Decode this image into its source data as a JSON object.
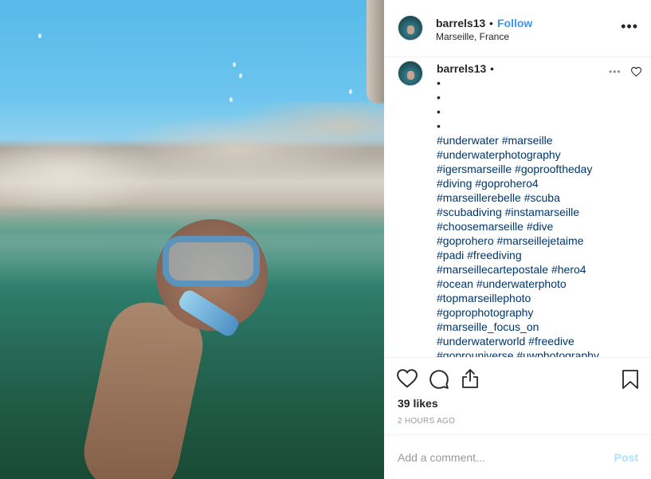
{
  "post": {
    "username": "barrels13",
    "separator": "•",
    "follow_label": "Follow",
    "location": "Marseille, France",
    "more_icon": "more-horizontal-icon"
  },
  "caption": {
    "username": "barrels13",
    "separator": "•",
    "lines": [
      "•",
      "•",
      "•",
      "•",
      "#underwater #marseille",
      "#underwaterphotography",
      "#igersmarseille #goprooftheday",
      "#diving #goprohero4",
      "#marseillerebelle #scuba",
      "#scubadiving #instamarseille",
      "#choosemarseille #dive",
      "#goprohero #marseillejetaime",
      "#padi #freediving",
      "#marseillecartepostale #hero4",
      "#ocean #underwaterphoto",
      "#topmarseillephoto",
      "#goprophotography",
      "#marseille_focus_on",
      "#underwaterworld #freedive",
      "#goprouniverse #uwphotography"
    ]
  },
  "actions": {
    "like_icon": "heart-icon",
    "comment_icon": "comment-bubble-icon",
    "share_icon": "share-icon",
    "save_icon": "bookmark-icon",
    "likes": "39 likes",
    "timestamp": "2 HOURS AGO"
  },
  "add_comment": {
    "placeholder": "Add a comment...",
    "post_label": "Post"
  },
  "colors": {
    "link_blue": "#3897f0",
    "hashtag": "#003569",
    "post_disabled": "#b2dffc"
  }
}
